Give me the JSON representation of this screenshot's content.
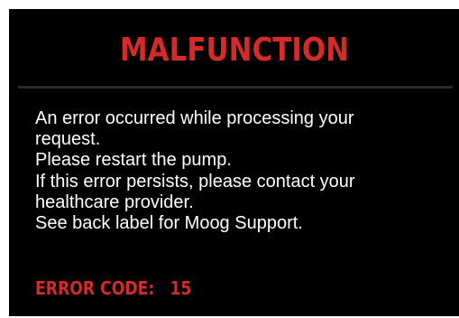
{
  "colors": {
    "background": "#000000",
    "accent": "#d42a2a",
    "text": "#ffffff",
    "divider": "#2a2a2a"
  },
  "dialog": {
    "title": "MALFUNCTION",
    "message_lines": [
      "An error occurred while processing your",
      "request.",
      "Please restart the pump.",
      "If this error persists, please contact your",
      "healthcare provider.",
      "See back label for Moog Support."
    ],
    "error_label": "ERROR CODE:",
    "error_code": "15"
  }
}
